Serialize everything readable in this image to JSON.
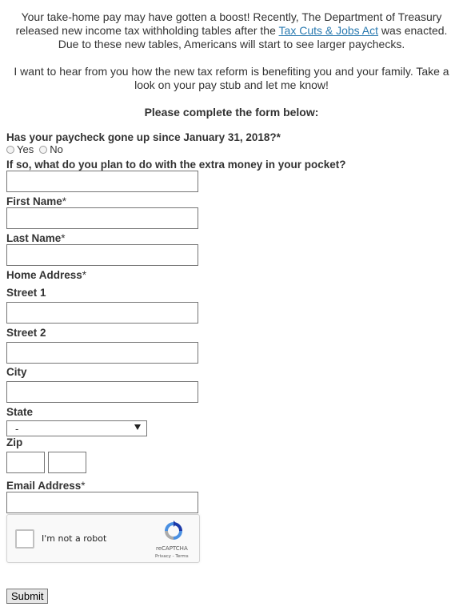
{
  "intro": {
    "p1_part1": "Your take-home pay may have gotten a boost! Recently, The Department of Treasury released new income tax withholding tables after the ",
    "p1_link": "Tax Cuts & Jobs Act",
    "p1_part2": " was enacted. Due to these new tables, Americans will start to see larger paychecks.",
    "p2": "I want to hear from you how the new tax reform is benefiting you and your family. Take a look on your pay stub and let me know!"
  },
  "form": {
    "heading": "Please complete the form below:",
    "q_paycheck": "Has your paycheck gone up since January 31, 2018?*",
    "opt_yes": "Yes",
    "opt_no": "No",
    "q_extra_money": "If so, what do you plan to do with the extra money in your pocket?",
    "first_name": "First Name",
    "last_name": "Last Name",
    "home_address": "Home Address",
    "required_mark": "*",
    "street1": "Street 1",
    "street2": "Street 2",
    "city": "City",
    "state": "State",
    "state_value": "-",
    "zip": "Zip",
    "email": "Email Address",
    "submit": "Submit"
  },
  "captcha": {
    "label": "I'm not a robot",
    "brand": "reCAPTCHA",
    "links": "Privacy - Terms"
  }
}
